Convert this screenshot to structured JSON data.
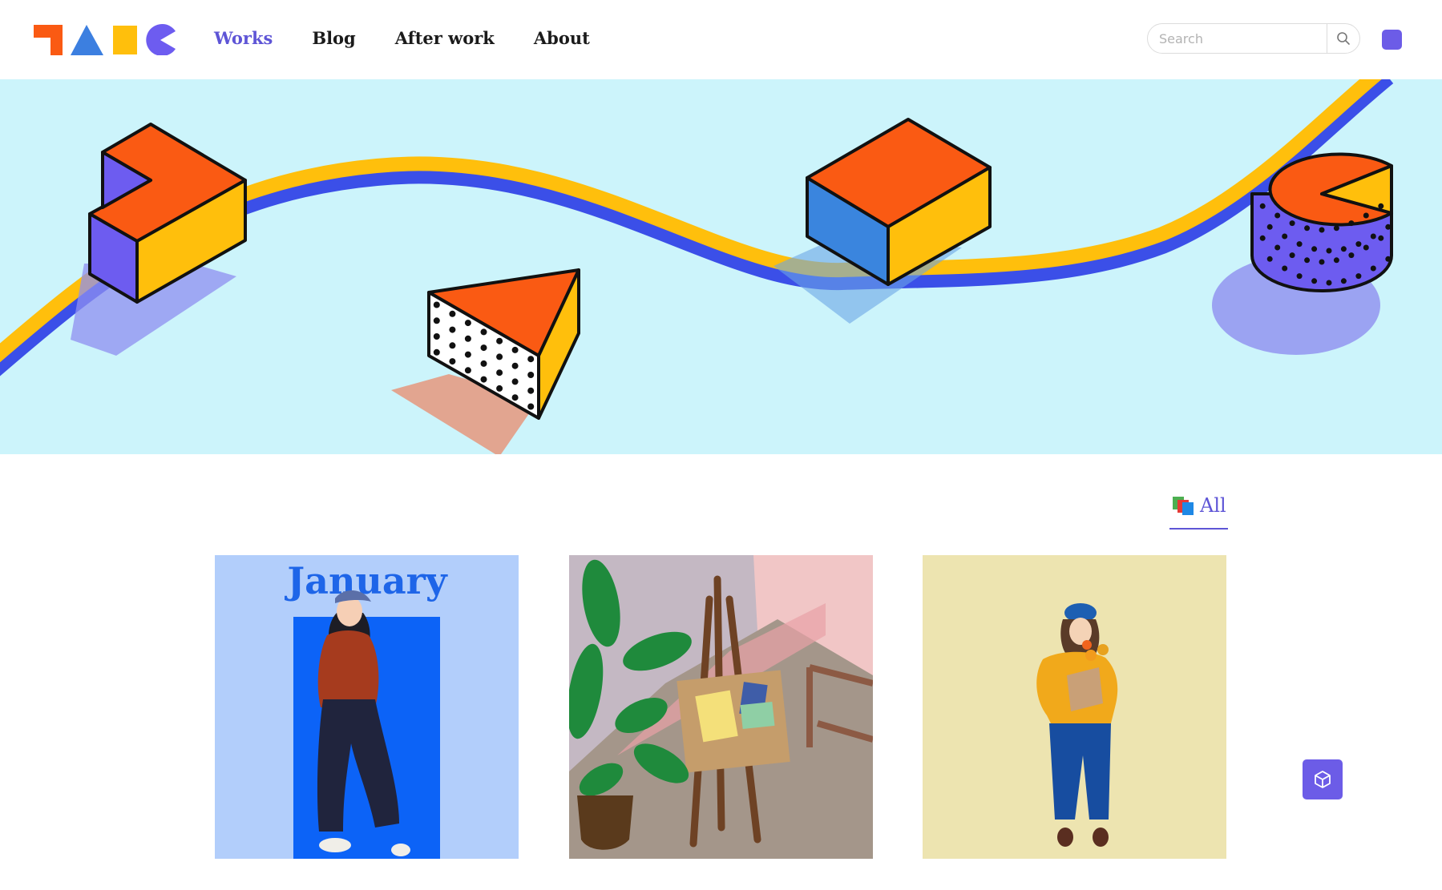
{
  "nav": {
    "items": [
      {
        "label": "Works",
        "active": true
      },
      {
        "label": "Blog",
        "active": false
      },
      {
        "label": "After work",
        "active": false
      },
      {
        "label": "About",
        "active": false
      }
    ]
  },
  "search": {
    "placeholder": "Search",
    "value": ""
  },
  "filter": {
    "label": "All"
  },
  "gallery": {
    "cards": [
      {
        "title_text": "January"
      },
      {},
      {}
    ]
  },
  "colors": {
    "accent": "#5e55d6",
    "button": "#6c5ce7",
    "banner_bg": "#ccf4fb",
    "orange": "#fa5a13",
    "yellow": "#ffbf0c",
    "blue": "#3c7fe0",
    "purple": "#6d5cf0"
  },
  "icons": {
    "search": "search-icon",
    "floating": "cube-icon",
    "filter": "stack-icon"
  }
}
